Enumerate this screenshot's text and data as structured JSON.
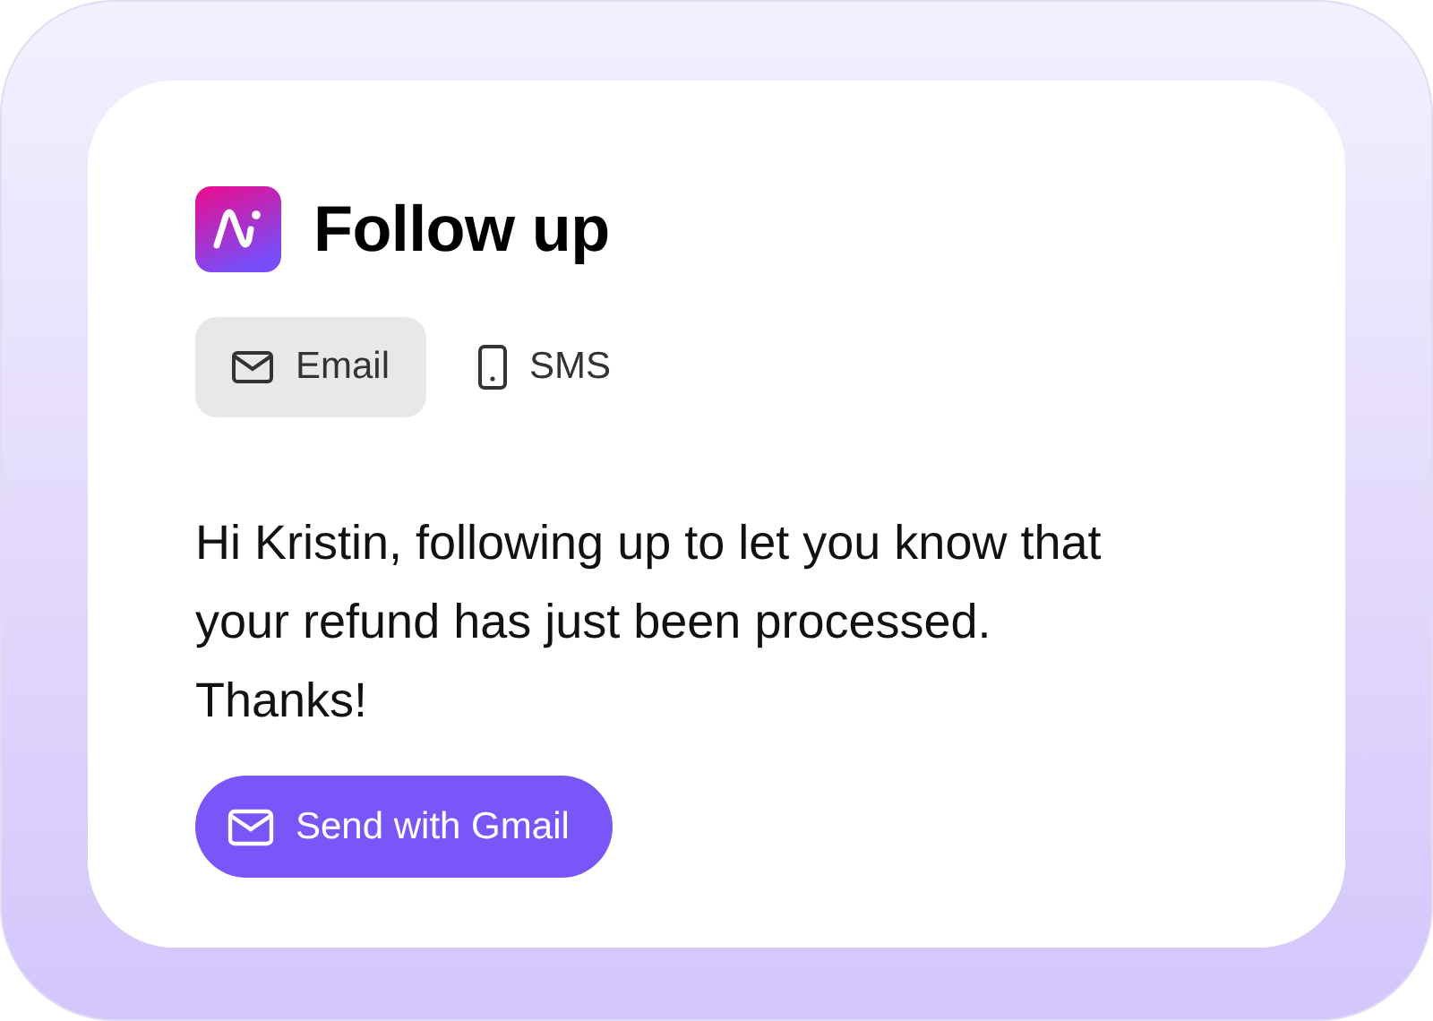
{
  "title": "Follow up",
  "tabs": [
    {
      "label": "Email",
      "kind": "email",
      "selected": true
    },
    {
      "label": "SMS",
      "kind": "sms",
      "selected": false
    }
  ],
  "message": "Hi Kristin, following up to let you know that your refund has just been processed. Thanks!",
  "send_button": {
    "label": "Send with Gmail"
  }
}
